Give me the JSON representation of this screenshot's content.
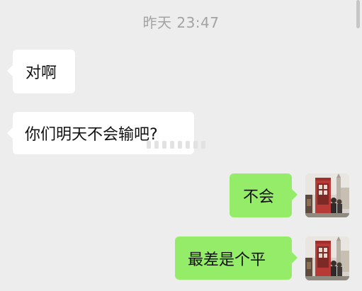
{
  "chat": {
    "timestamp": "昨天 23:47",
    "messages": [
      {
        "direction": "incoming",
        "text": "对啊"
      },
      {
        "direction": "incoming",
        "text": "你们明天不会输吧?"
      },
      {
        "direction": "outgoing",
        "text": "不会"
      },
      {
        "direction": "outgoing",
        "text": "最差是个平"
      }
    ]
  },
  "colors": {
    "background": "#ededed",
    "incoming_bubble": "#ffffff",
    "outgoing_bubble": "#95ec69",
    "timestamp_text": "#a3a3a3"
  },
  "icons": {
    "avatar": "london-telephone-booth-photo-avatar"
  }
}
